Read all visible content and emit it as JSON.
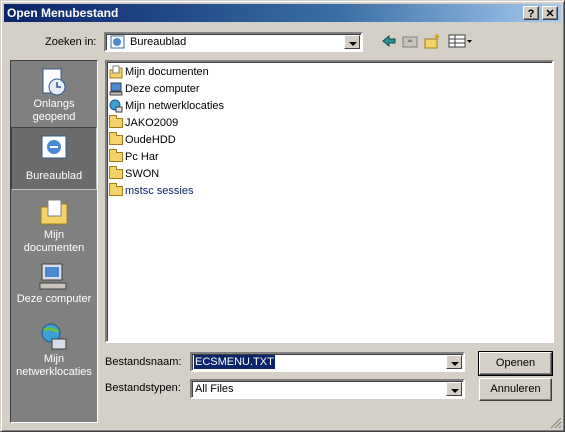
{
  "window": {
    "title": "Open Menubestand",
    "help_btn": "?",
    "close_btn": "✕"
  },
  "lookin": {
    "label": "Zoeken in:",
    "value": "Bureaublad"
  },
  "places": [
    {
      "label1": "Onlangs",
      "label2": "geopend"
    },
    {
      "label1": "Bureaublad",
      "label2": ""
    },
    {
      "label1": "Mijn",
      "label2": "documenten"
    },
    {
      "label1": "Deze computer",
      "label2": ""
    },
    {
      "label1": "Mijn",
      "label2": "netwerklocaties"
    }
  ],
  "files": [
    {
      "name": "Mijn documenten",
      "icon": "my-documents-icon"
    },
    {
      "name": "Deze computer",
      "icon": "computer-icon"
    },
    {
      "name": "Mijn netwerklocaties",
      "icon": "network-icon"
    },
    {
      "name": "JAKO2009",
      "icon": "folder-icon"
    },
    {
      "name": "OudeHDD",
      "icon": "folder-icon"
    },
    {
      "name": "Pc Har",
      "icon": "folder-icon"
    },
    {
      "name": "SWON",
      "icon": "folder-icon"
    },
    {
      "name": "mstsc sessies",
      "icon": "shortcut-folder-icon"
    }
  ],
  "filename": {
    "label": "Bestandsnaam:",
    "value": "ECSMENU.TXT"
  },
  "filetype": {
    "label": "Bestandstypen:",
    "value": "All Files"
  },
  "buttons": {
    "open": "Openen",
    "cancel": "Annuleren"
  },
  "colors": {
    "title_start": "#0a246a",
    "title_end": "#a6caf0",
    "link": "#0a246a"
  }
}
